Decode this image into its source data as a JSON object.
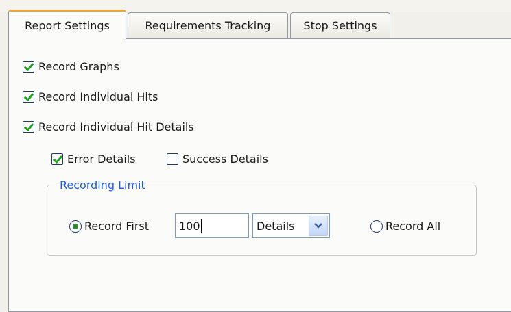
{
  "tabs": [
    {
      "label": "Report Settings",
      "active": true
    },
    {
      "label": "Requirements Tracking",
      "active": false
    },
    {
      "label": "Stop Settings",
      "active": false
    }
  ],
  "options": {
    "record_graphs": {
      "label": "Record Graphs",
      "checked": true
    },
    "record_individual_hits": {
      "label": "Record Individual Hits",
      "checked": true
    },
    "record_hit_details": {
      "label": "Record Individual Hit Details",
      "checked": true
    },
    "error_details": {
      "label": "Error Details",
      "checked": true
    },
    "success_details": {
      "label": "Success Details",
      "checked": false
    }
  },
  "recording_limit": {
    "title": "Recording Limit",
    "record_first_label": "Record First",
    "record_first_selected": true,
    "count_value": "100",
    "unit_selected": "Details",
    "record_all_label": "Record All",
    "record_all_selected": false
  },
  "colors": {
    "active_tab_accent": "#f2a43a",
    "check_mark": "#21a121",
    "group_title": "#1d5fd8"
  },
  "icons": {
    "dropdown": "chevron-down-icon"
  }
}
